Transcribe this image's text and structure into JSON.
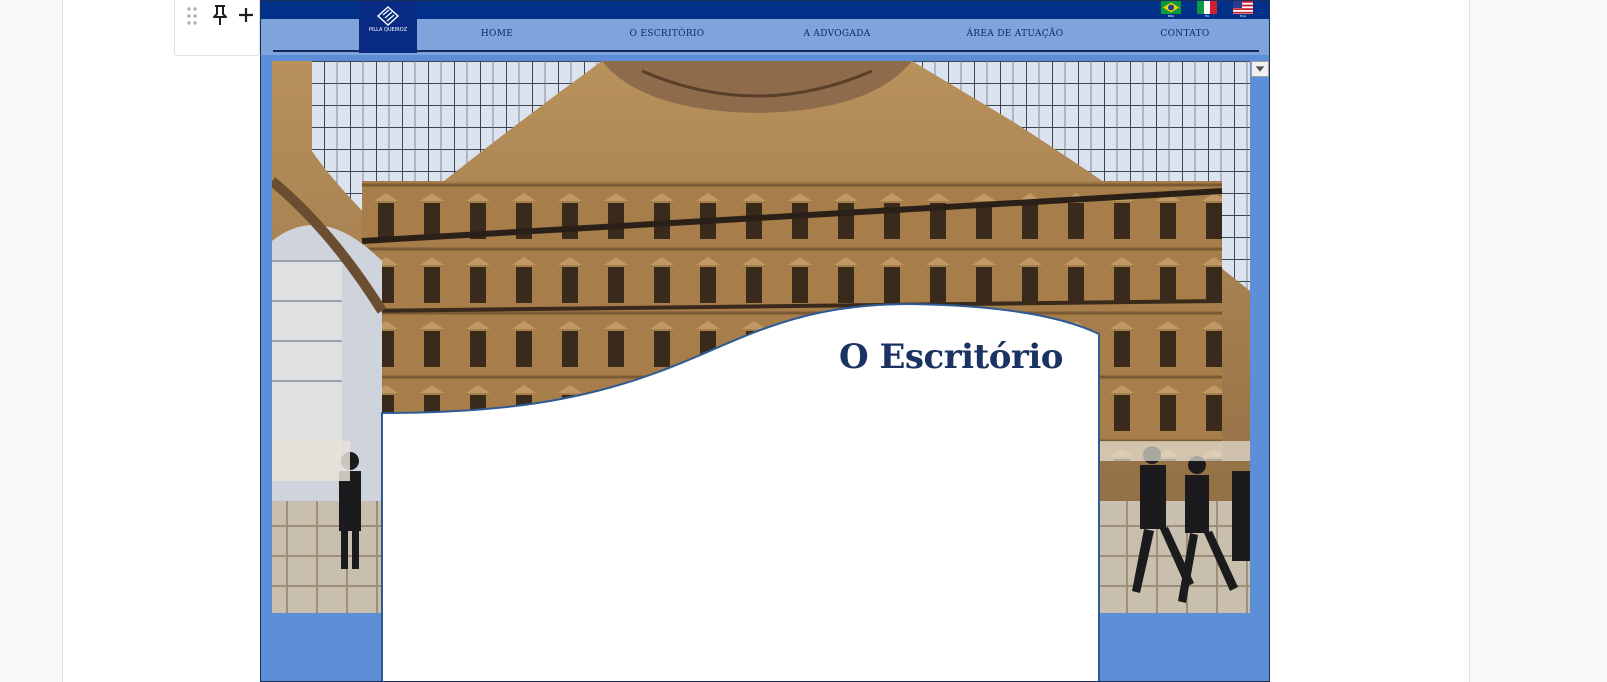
{
  "site": {
    "logo_text": "PILLA QUEIROZ",
    "flags": [
      {
        "name": "flag-brazil",
        "code": "BRA"
      },
      {
        "name": "flag-italy",
        "code": "ITA"
      },
      {
        "name": "flag-usa",
        "code": "EUA"
      }
    ],
    "nav": [
      "HOME",
      "O ESCRITÓRIO",
      "A ADVOGADA",
      "ÁREA DE ATUAÇÃO",
      "CONTATO"
    ],
    "heading": "O Escritório"
  },
  "colors": {
    "top_strip": "#003087",
    "nav_bar": "#7fa4dc",
    "page_blue": "#5d8fd8",
    "heading": "#1a3363"
  },
  "toolbar_icons": [
    "drag-handle-icon",
    "pin-icon",
    "plus-icon"
  ]
}
